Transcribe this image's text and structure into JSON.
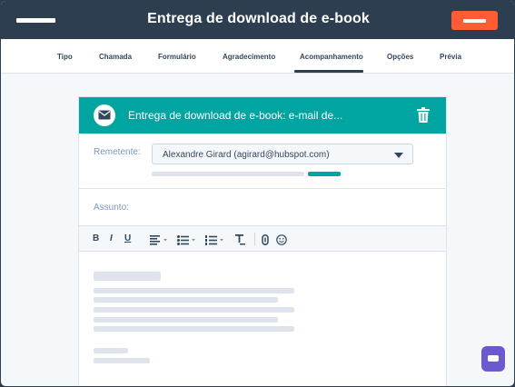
{
  "header": {
    "title": "Entrega de download de e-book"
  },
  "tabs": [
    {
      "label": "Tipo"
    },
    {
      "label": "Chamada"
    },
    {
      "label": "Formulário"
    },
    {
      "label": "Agradecimento"
    },
    {
      "label": "Acompanhamento"
    },
    {
      "label": "Opções"
    },
    {
      "label": "Prévia"
    }
  ],
  "active_tab": "Acompanhamento",
  "card": {
    "title": "Entrega de download de e-book: e-mail de...",
    "sender_label": "Remetente:",
    "sender_value": "Alexandre Girard (agirard@hubspot.com)",
    "subject_label": "Assunto:"
  },
  "toolbar": {
    "bold": "B",
    "italic": "I",
    "underline": "U"
  },
  "colors": {
    "topbar": "#2d3e50",
    "accent_teal": "#00a4a0",
    "accent_orange": "#ff5c35",
    "chat_button": "#6a5acd"
  },
  "icons": [
    "menu-icon",
    "mail-icon",
    "trash-icon",
    "align-icon",
    "bullet-list-icon",
    "numbered-list-icon",
    "clear-format-icon",
    "link-icon",
    "emoji-icon",
    "chat-icon"
  ]
}
